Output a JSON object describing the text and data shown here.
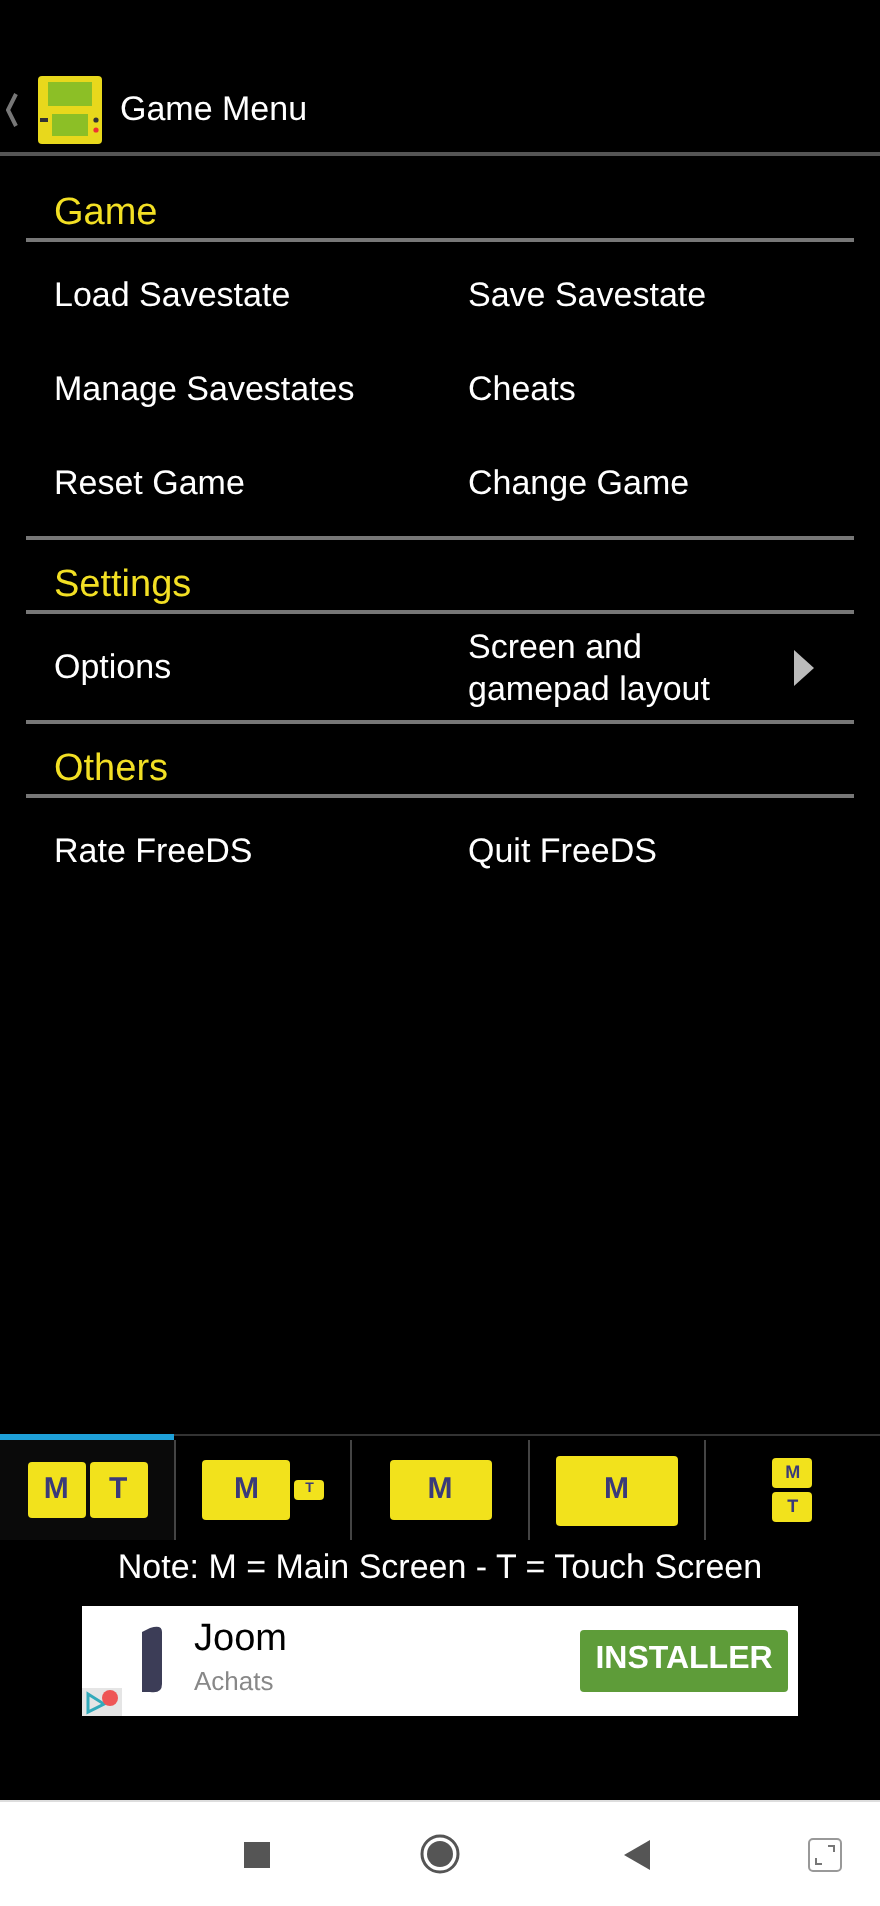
{
  "header": {
    "title": "Game Menu"
  },
  "sections": [
    {
      "title": "Game",
      "items": [
        {
          "label": "Load Savestate",
          "has_submenu": false
        },
        {
          "label": "Save Savestate",
          "has_submenu": false
        },
        {
          "label": "Manage Savestates",
          "has_submenu": false
        },
        {
          "label": "Cheats",
          "has_submenu": false
        },
        {
          "label": "Reset Game",
          "has_submenu": false
        },
        {
          "label": "Change Game",
          "has_submenu": false
        }
      ]
    },
    {
      "title": "Settings",
      "items": [
        {
          "label": "Options",
          "has_submenu": false
        },
        {
          "label": "Screen and gamepad layout",
          "has_submenu": true
        }
      ]
    },
    {
      "title": "Others",
      "items": [
        {
          "label": "Rate FreeDS",
          "has_submenu": false
        },
        {
          "label": "Quit FreeDS",
          "has_submenu": false
        }
      ]
    }
  ],
  "layouts": [
    {
      "kind": "side_by_side",
      "selected": true,
      "main": "M",
      "touch": "T"
    },
    {
      "kind": "main_with_small_touch",
      "selected": false,
      "main": "M",
      "touch": "T"
    },
    {
      "kind": "main_only",
      "selected": false,
      "main": "M"
    },
    {
      "kind": "main_large",
      "selected": false,
      "main": "M"
    },
    {
      "kind": "stacked",
      "selected": false,
      "main": "M",
      "touch": "T"
    }
  ],
  "note": "Note: M = Main Screen - T = Touch Screen",
  "ad": {
    "title": "Joom",
    "subtitle": "Achats",
    "button": "INSTALLER"
  }
}
